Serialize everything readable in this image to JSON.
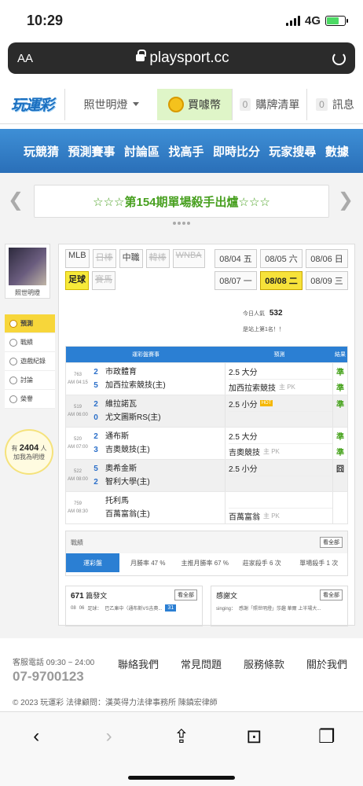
{
  "status": {
    "time": "10:29",
    "network": "4G"
  },
  "browser": {
    "aa": "AA",
    "url": "playsport.cc"
  },
  "topnav": {
    "logo": "玩運彩",
    "user": "照世明燈",
    "coins": "買噱幣",
    "cart_count": "0",
    "cart": "購牌清單",
    "msg_count": "0",
    "msg": "訊息"
  },
  "mainnav": [
    "玩競猜",
    "預測賽事",
    "討論區",
    "找高手",
    "即時比分",
    "玩家搜尋",
    "數據"
  ],
  "marquee": "☆☆☆第154期單場殺手出爐☆☆☆",
  "profile": {
    "name": "照世明燈"
  },
  "side_menu": [
    "預測",
    "戰績",
    "遊戲紀錄",
    "討論",
    "榮譽"
  ],
  "bulb": {
    "prefix": "有",
    "count": "2404",
    "suffix": "人",
    "text": "加我為明燈"
  },
  "leagues": [
    {
      "label": "MLB",
      "state": "normal"
    },
    {
      "label": "日棒",
      "state": "disabled"
    },
    {
      "label": "中職",
      "state": "normal"
    },
    {
      "label": "韓棒",
      "state": "disabled"
    },
    {
      "label": "WNBA",
      "state": "disabled"
    },
    {
      "label": "足球",
      "state": "selected"
    },
    {
      "label": "賽馬",
      "state": "disabled"
    }
  ],
  "dates": [
    {
      "label": "08/04 五",
      "selected": false
    },
    {
      "label": "08/05 六",
      "selected": false
    },
    {
      "label": "08/06 日",
      "selected": false
    },
    {
      "label": "08/07 一",
      "selected": false
    },
    {
      "label": "08/08 二",
      "selected": true
    },
    {
      "label": "08/09 三",
      "selected": false
    }
  ],
  "stats": {
    "today_label": "今日人氣",
    "today_value": "532",
    "rank_text": "是站上第1名！！"
  },
  "table": {
    "headers": {
      "game": "運彩盤賽事",
      "prediction": "預測",
      "result": "結果"
    },
    "rows": [
      {
        "id": "763",
        "time": "AM 04:15",
        "s1": "2",
        "s2": "5",
        "t1": "市政體育",
        "t2": "加西拉索競技(主)",
        "p1": "2.5 大分",
        "p2": "加西拉索競技",
        "p2hint": "主 PK",
        "r1": "準",
        "r2": "準",
        "hot": false
      },
      {
        "id": "519",
        "time": "AM 06:00",
        "s1": "2",
        "s2": "0",
        "t1": "維拉諾瓦",
        "t2": "尤文圖斯RS(主)",
        "p1": "2.5 小分",
        "p2": "",
        "p2hint": "",
        "r1": "準",
        "r2": "",
        "hot": true
      },
      {
        "id": "520",
        "time": "AM 07:00",
        "s1": "2",
        "s2": "3",
        "t1": "通布斯",
        "t2": "吉奧競技(主)",
        "p1": "2.5 大分",
        "p2": "吉奧競技",
        "p2hint": "主 PK",
        "r1": "準",
        "r2": "準",
        "hot": false
      },
      {
        "id": "522",
        "time": "AM 08:00",
        "s1": "5",
        "s2": "2",
        "t1": "奧希金斯",
        "t2": "智利大學(主)",
        "p1": "2.5 小分",
        "p2": "",
        "p2hint": "",
        "r1": "囧",
        "r2": "",
        "hot": false
      },
      {
        "id": "759",
        "time": "AM 08:30",
        "s1": "",
        "s2": "",
        "t1": "托利馬",
        "t2": "百萬富翁(主)",
        "p1": "",
        "p2": "百萬富翁",
        "p2hint": "主 PK",
        "r1": "",
        "r2": "",
        "hot": false
      }
    ]
  },
  "record": {
    "title": "戰績",
    "more": "看全部",
    "label": "運彩盤",
    "month_rate": "月勝率 47 %",
    "home_rate": "主推月勝率 67 %",
    "killer": "莊家殺手 6 次",
    "single": "單場殺手 1 次"
  },
  "posts": {
    "count": "671",
    "title": "篇發文",
    "more": "看全部",
    "date": "08",
    "day": "06",
    "cat": "足球：",
    "subject": "巴乙庫中（通布斯VS吉奧...",
    "badge": "31"
  },
  "recommend": {
    "title": "感謝文",
    "more": "看全部",
    "user": "singing：",
    "text": "感謝「照世明燈」莎趣 華爾 上半場大..."
  },
  "footer": {
    "svc": "客服電話 09:30 ~ 24:00",
    "phone": "07-9700123",
    "links": [
      "聯絡我們",
      "常見問題",
      "服務條款",
      "關於我們"
    ],
    "copy": "© 2023 玩運彩 法律顧問：漢英得力法律事務所 陳鎮宏律師"
  },
  "colors": {
    "accent": "#2b7fd3",
    "win": "#47a31d",
    "highlight": "#f7e23a"
  }
}
